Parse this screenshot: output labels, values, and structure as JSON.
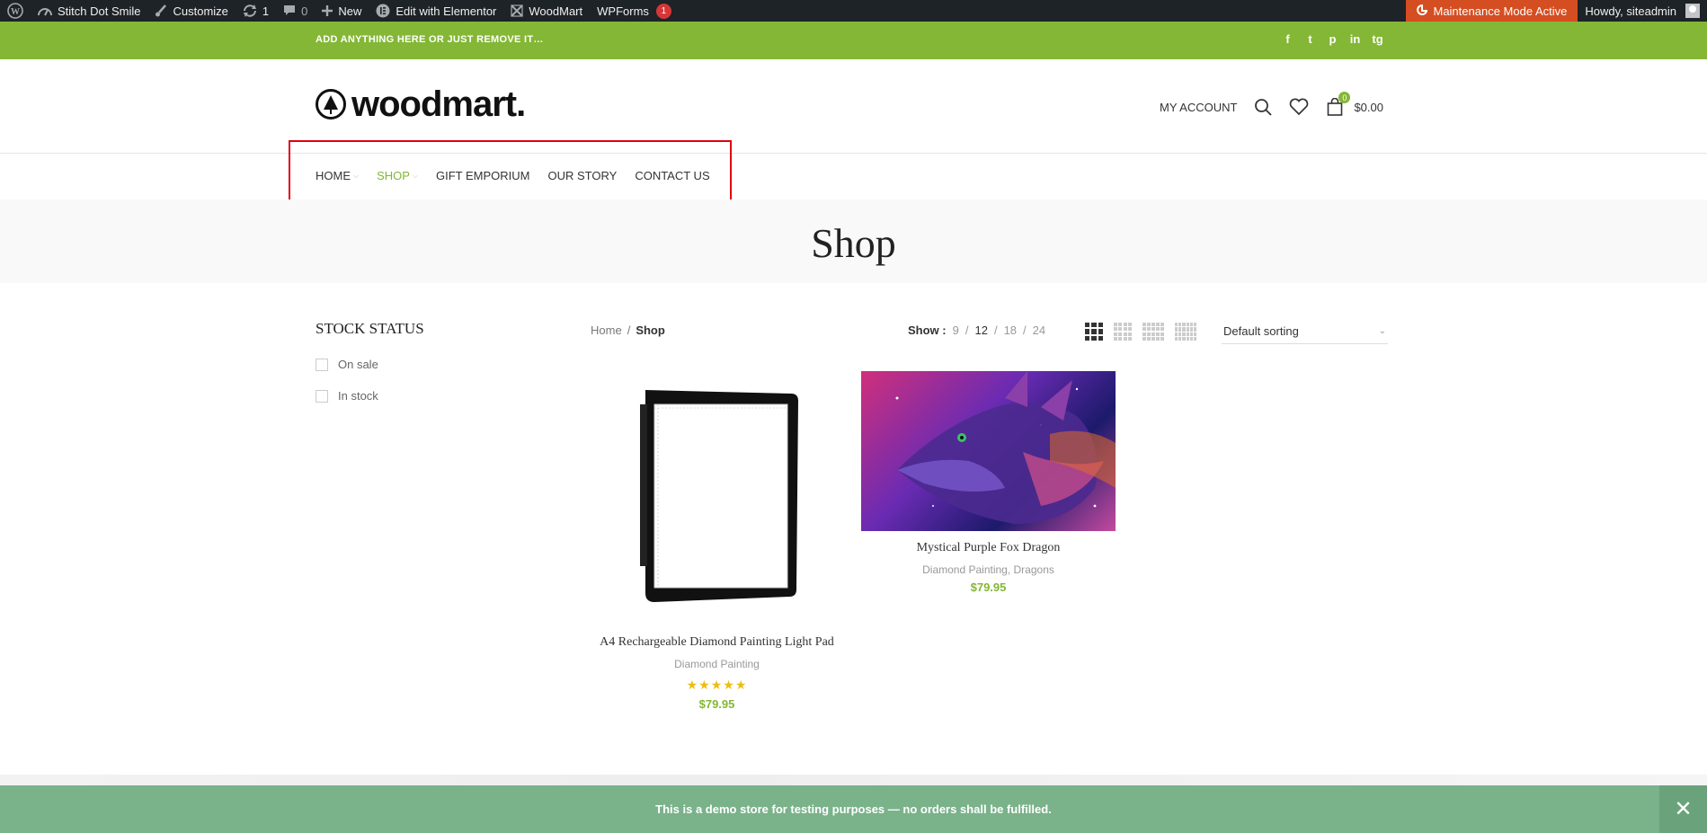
{
  "adminbar": {
    "site_name": "Stitch Dot Smile",
    "customize": "Customize",
    "updates": "1",
    "comments": "0",
    "new": "New",
    "elementor": "Edit with Elementor",
    "woodmart": "WoodMart",
    "wpforms": "WPForms",
    "wpforms_badge": "1",
    "maintenance": "Maintenance Mode Active",
    "howdy": "Howdy, siteadmin"
  },
  "topbar": {
    "promo": "ADD ANYTHING HERE OR JUST REMOVE IT…",
    "social": [
      "f",
      "t",
      "p",
      "in",
      "tg"
    ]
  },
  "header": {
    "logo_text": "woodmart.",
    "my_account": "MY ACCOUNT",
    "cart_count": "0",
    "cart_total": "$0.00"
  },
  "nav": {
    "items": [
      {
        "label": "HOME"
      },
      {
        "label": "SHOP"
      },
      {
        "label": "GIFT EMPORIUM"
      },
      {
        "label": "OUR STORY"
      },
      {
        "label": "CONTACT US"
      }
    ]
  },
  "page": {
    "title": "Shop"
  },
  "sidebar": {
    "title": "STOCK STATUS",
    "filters": [
      "On sale",
      "In stock"
    ]
  },
  "toolbar": {
    "breadcrumb_home": "Home",
    "breadcrumb_sep": "/",
    "breadcrumb_current": "Shop",
    "show_label": "Show :",
    "show_options": [
      "9",
      "12",
      "18",
      "24"
    ],
    "show_sep": "/",
    "sorting": "Default sorting"
  },
  "products": [
    {
      "name": "A4 Rechargeable Diamond Painting Light Pad",
      "category": "Diamond Painting",
      "stars": "★★★★★",
      "price": "$79.95"
    },
    {
      "name": "Mystical Purple Fox Dragon",
      "category": "Diamond Painting, Dragons",
      "price": "$79.95"
    }
  ],
  "demo_notice": "This is a demo store for testing purposes — no orders shall be fulfilled.",
  "colors": {
    "accent": "#83b735",
    "notice": "#7ab28a",
    "admin_bg": "#1d2327",
    "maintenance": "#d54e21",
    "highlight": "#e0000f"
  }
}
